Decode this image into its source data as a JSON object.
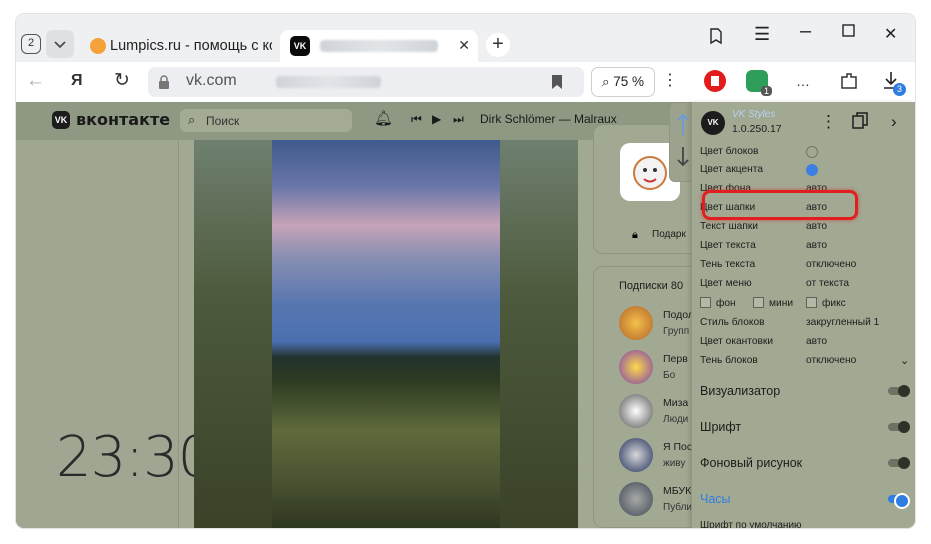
{
  "browser": {
    "tab_count": "2",
    "tabs": [
      {
        "title": "Lumpics.ru - помощь с ком"
      },
      {
        "title": ""
      }
    ],
    "address": "vk.com",
    "zoom": "75 %",
    "ext_badge": "1",
    "downloads_badge": "3"
  },
  "vk": {
    "brand": "вконтакте",
    "search_placeholder": "Поиск",
    "track": "Dirk Schlömer — Malraux",
    "clock": "23:30",
    "gift_label": "Подарк",
    "subs_title": "Подписки",
    "subs_count": "80",
    "subs": [
      {
        "name": "Подол",
        "desc": "Групп"
      },
      {
        "name": "Перв",
        "desc": "Бо"
      },
      {
        "name": "Миза",
        "desc": "Люди"
      },
      {
        "name": "Я Пос",
        "desc": "живу"
      },
      {
        "name": "МБУК",
        "desc": "Публи"
      }
    ]
  },
  "panel": {
    "name": "VK Styles",
    "version": "1.0.250.17",
    "rows": [
      {
        "k": "Цвет блоков",
        "v": ""
      },
      {
        "k": "Цвет акцента",
        "v": ""
      },
      {
        "k": "Цвет фона",
        "v": "авто"
      },
      {
        "k": "Цвет шапки",
        "v": "авто"
      },
      {
        "k": "Текст шапки",
        "v": "авто"
      },
      {
        "k": "Цвет текста",
        "v": "авто"
      },
      {
        "k": "Тень текста",
        "v": "отключено"
      },
      {
        "k": "Цвет меню",
        "v": "от текста"
      }
    ],
    "checks": [
      "фон",
      "мини",
      "фикс"
    ],
    "rows2": [
      {
        "k": "Стиль блоков",
        "v": "закругленный 1"
      },
      {
        "k": "Цвет окантовки",
        "v": "авто"
      },
      {
        "k": "Тень блоков",
        "v": "отключено"
      }
    ],
    "sections": [
      {
        "k": "Визуализатор",
        "on": false
      },
      {
        "k": "Шрифт",
        "on": false
      },
      {
        "k": "Фоновый рисунок",
        "on": false
      },
      {
        "k": "Часы",
        "on": true
      }
    ],
    "cut": "Шрифт по умолчанию"
  },
  "colors": {
    "accent": "#2f7de0",
    "highlight": "#e02020",
    "vk_bg": "#a2a993"
  }
}
